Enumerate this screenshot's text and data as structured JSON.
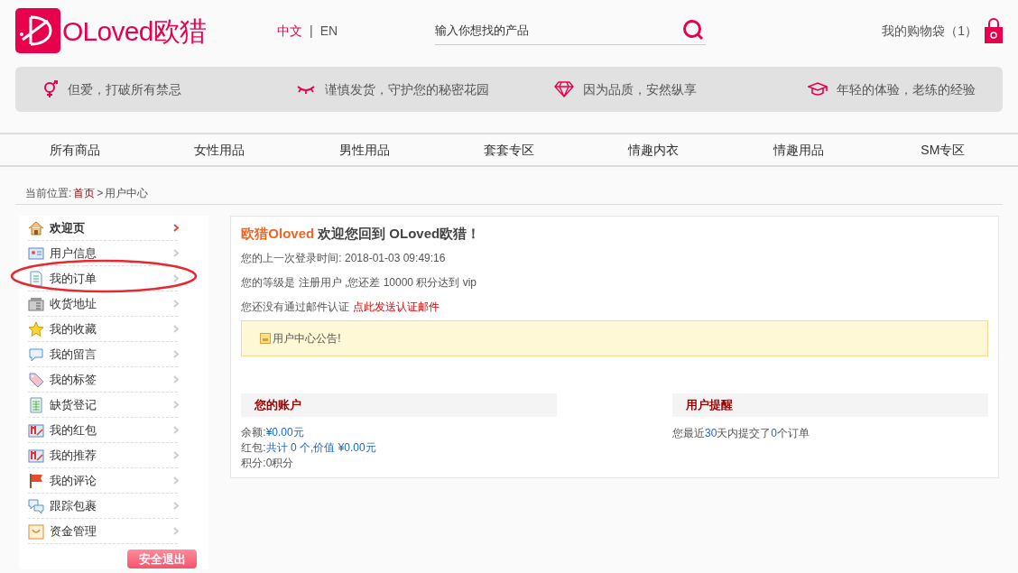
{
  "header": {
    "logo_text": "OLoved欧猎",
    "languages": [
      {
        "label": "中文",
        "selected": true
      },
      {
        "label": "EN",
        "selected": false
      }
    ],
    "language_separator": "|",
    "search": {
      "placeholder": "输入你想找的产品"
    },
    "cart": {
      "label": "我的购物袋（1）"
    }
  },
  "features": [
    "但爱，打破所有禁忌",
    "谨慎发货，守护您的秘密花园",
    "因为品质，安然纵享",
    "年轻的体验，老练的经验"
  ],
  "nav": [
    "所有商品",
    "女性用品",
    "男性用品",
    "套套专区",
    "情趣内衣",
    "情趣用品",
    "SM专区"
  ],
  "breadcrumb": {
    "prefix": "当前位置:",
    "home": "首页",
    "separator": ">",
    "current": "用户中心"
  },
  "sidebar": {
    "items": [
      {
        "label": "欢迎页",
        "selected": true
      },
      {
        "label": "用户信息",
        "selected": false
      },
      {
        "label": "我的订单",
        "selected": false
      },
      {
        "label": "收货地址",
        "selected": false
      },
      {
        "label": "我的收藏",
        "selected": false
      },
      {
        "label": "我的留言",
        "selected": false
      },
      {
        "label": "我的标签",
        "selected": false
      },
      {
        "label": "缺货登记",
        "selected": false
      },
      {
        "label": "我的红包",
        "selected": false
      },
      {
        "label": "我的推荐",
        "selected": false
      },
      {
        "label": "我的评论",
        "selected": false
      },
      {
        "label": "跟踪包裹",
        "selected": false
      },
      {
        "label": "资金管理",
        "selected": false
      }
    ],
    "logout": "安全退出"
  },
  "welcome": {
    "brand": "欧猎Oloved",
    "title": "欢迎您回到 OLoved欧猎！",
    "last_login": "您的上一次登录时间: 2018-01-03 09:49:16",
    "level_info": "您的等级是 注册用户 ,您还差 10000 积分达到 vip",
    "email_prompt": "您还没有通过邮件认证",
    "email_link": "点此发送认证邮件",
    "notice": "用户中心公告!"
  },
  "account": {
    "title": "您的账户",
    "rows": [
      {
        "label": "余额:",
        "value": "¥0.00元"
      },
      {
        "label": "红包:",
        "value": "共计 0 个,价值 ¥0.00元"
      },
      {
        "label": "积分:0积分",
        "value": ""
      }
    ]
  },
  "reminder": {
    "title": "用户提醒",
    "parts": [
      {
        "text": "您最近",
        "highlight": false
      },
      {
        "text": "30",
        "highlight": true
      },
      {
        "text": "天内提交了",
        "highlight": false
      },
      {
        "text": "0",
        "highlight": true
      },
      {
        "text": "个订单",
        "highlight": false
      }
    ]
  }
}
